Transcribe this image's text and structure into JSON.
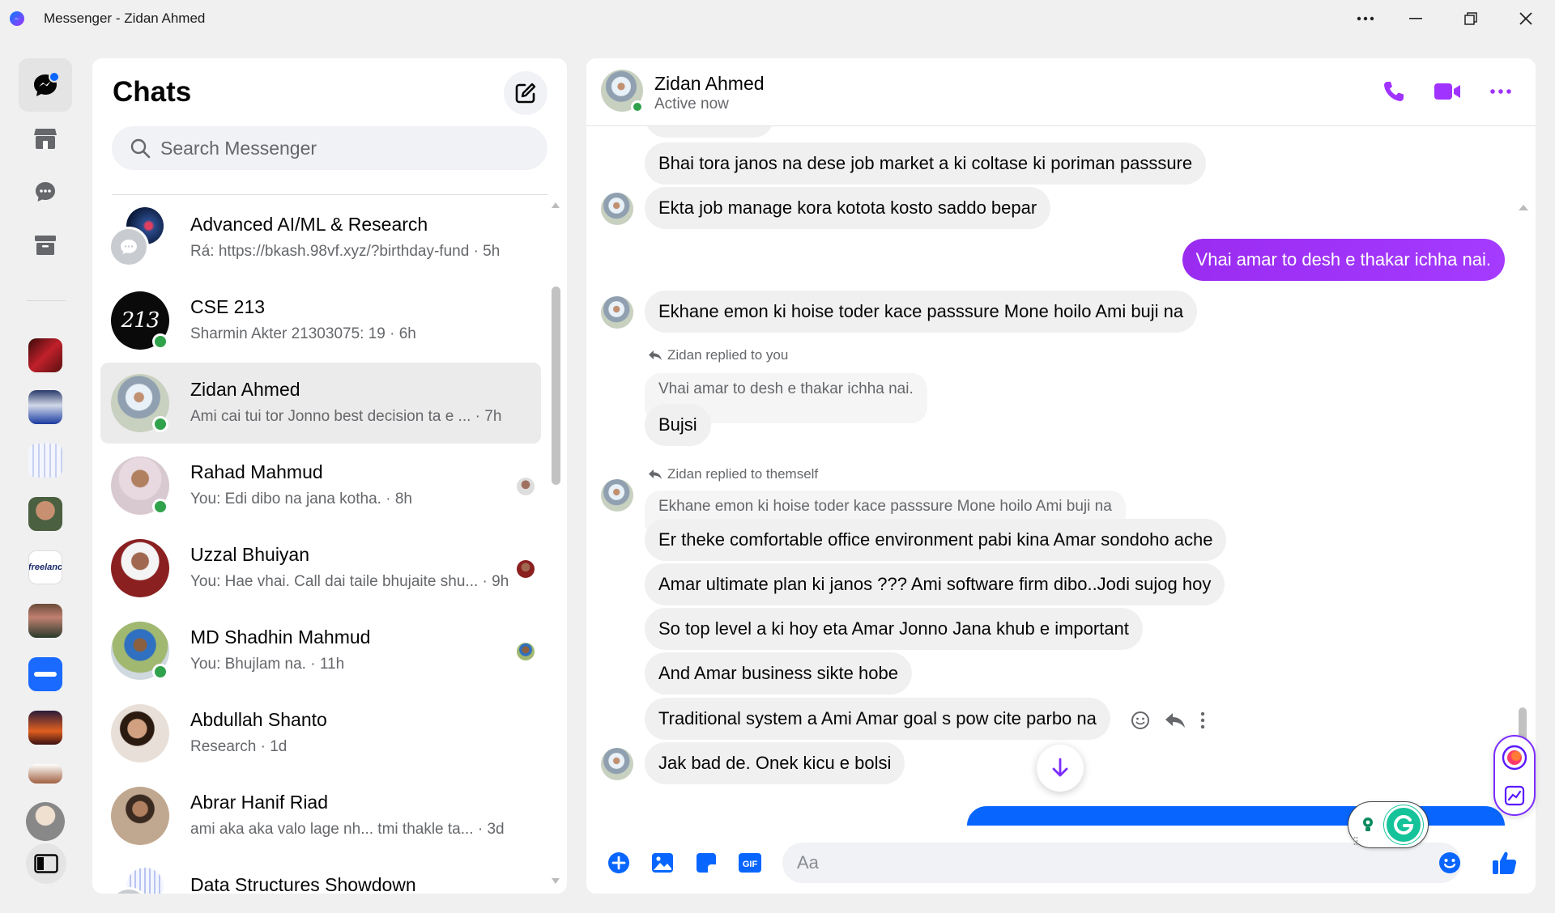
{
  "window": {
    "title": "Messenger - Zidan Ahmed"
  },
  "chats": {
    "title": "Chats",
    "search_placeholder": "Search Messenger",
    "items": [
      {
        "name": "Advanced AI/ML & Research",
        "preview": "Rá: https://bkash.98vf.xyz/?birthday-fund · 5h",
        "online": false
      },
      {
        "name": "CSE 213",
        "preview": "Sharmin Akter 21303075: 19 · 6h",
        "online": true
      },
      {
        "name": "Zidan Ahmed",
        "preview": "Ami cai tui tor Jonno best decision ta e ... · 7h",
        "online": true,
        "selected": true
      },
      {
        "name": "Rahad Mahmud",
        "preview": "You: Edi dibo na jana kotha. · 8h",
        "online": true
      },
      {
        "name": "Uzzal Bhuiyan",
        "preview": "You: Hae vhai. Call dai taile bhujaite shu... · 9h",
        "online": false
      },
      {
        "name": "MD Shadhin Mahmud",
        "preview": "You: Bhujlam na. · 11h",
        "online": true
      },
      {
        "name": "Abdullah Shanto",
        "preview": "Research · 1d",
        "online": false
      },
      {
        "name": "Abrar Hanif Riad",
        "preview": "ami aka aka valo lage nh... tmi thakle ta... · 3d",
        "online": false
      },
      {
        "name": "Data Structures Showdown",
        "preview": "",
        "online": false
      }
    ]
  },
  "conversation": {
    "name": "Zidan Ahmed",
    "status": "Active now",
    "messages": {
      "m1": "Bhai tora janos na dese job market a ki coltase ki poriman passsure",
      "m2": "Ekta job manage kora kotota kosto saddo bepar",
      "m3": "Vhai amar to desh e thakar ichha nai.",
      "m4": "Ekhane emon ki hoise toder kace passsure Mone hoilo Ami buji na",
      "replied1": "Zidan replied to you",
      "quote1": "Vhai amar to desh e thakar ichha nai.",
      "m5": "Bujsi",
      "replied2": "Zidan replied to themself",
      "quote2": "Ekhane emon ki hoise toder kace passsure Mone hoilo Ami buji na",
      "m6": "Er theke comfortable office environment pabi kina Amar sondoho ache",
      "m7": "Amar ultimate plan ki janos ??? Ami software firm dibo..Jodi sujog hoy",
      "m8": "So top level a ki hoy eta Amar Jonno Jana khub e important",
      "m9": "And Amar business sikte hobe",
      "m10": "Traditional system a Ami Amar goal s pow cite parbo na",
      "m11": "Jak bad de. Onek kicu e bolsi"
    },
    "composer_placeholder": "Aa"
  },
  "colors": {
    "accent": "#a033ff",
    "online": "#31a24c",
    "blue": "#0866ff"
  }
}
